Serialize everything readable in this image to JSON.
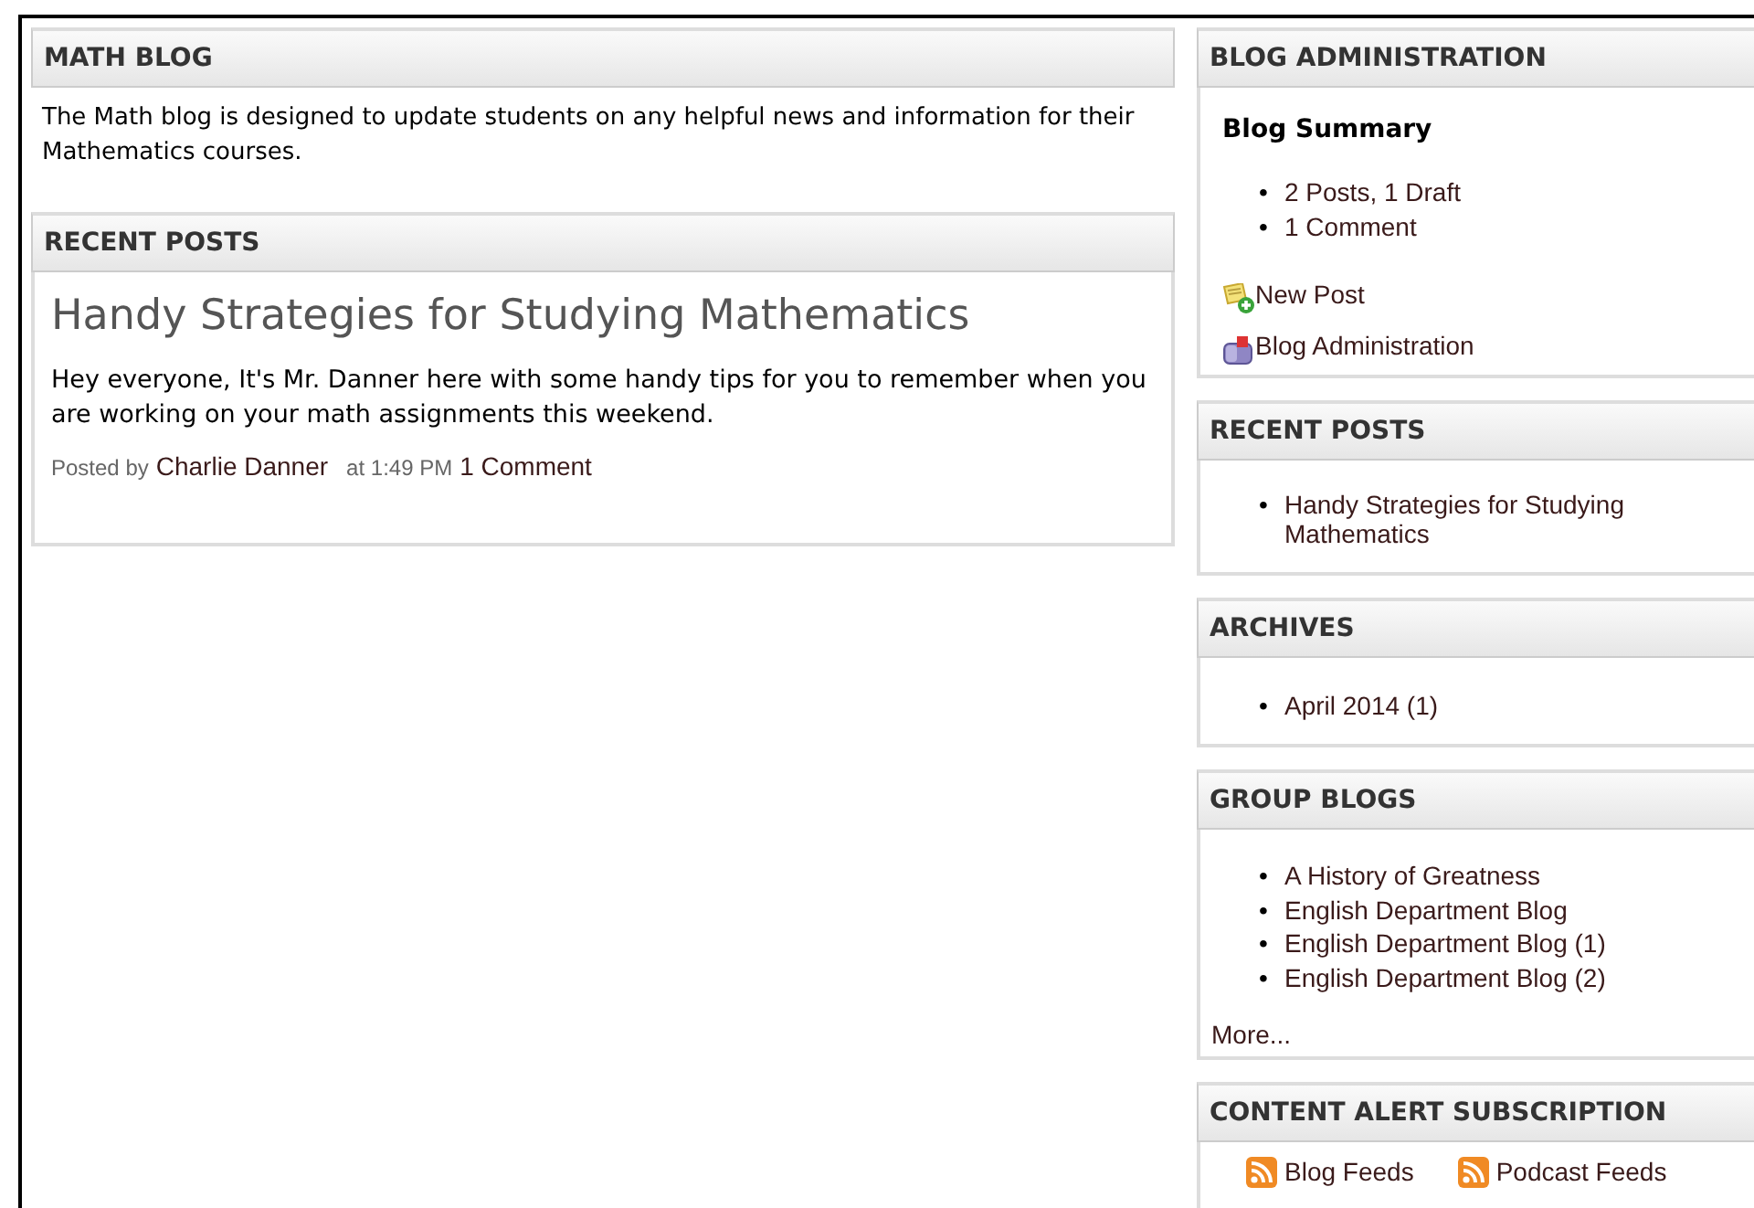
{
  "main": {
    "intro": {
      "title": "MATH BLOG",
      "text": "The Math blog is designed to update students on any helpful news and information for their Mathematics courses."
    },
    "recent_posts": {
      "title": "RECENT POSTS",
      "posts": [
        {
          "title": "Handy Strategies for Studying Mathematics",
          "excerpt": "Hey everyone, It's Mr. Danner here with some handy tips for you to remember when you are working on your math assignments this weekend.",
          "posted_by": "Posted by",
          "author": "Charlie Danner",
          "time": "at 1:49 PM",
          "comments": "1 Comment"
        }
      ]
    }
  },
  "sidebar": {
    "admin": {
      "title": "BLOG ADMINISTRATION",
      "summary_heading": "Blog Summary",
      "summary_items": [
        {
          "bullet": "•",
          "text": "2 Posts, 1 Draft"
        },
        {
          "bullet": "•",
          "text": "1 Comment"
        }
      ],
      "actions": [
        {
          "kind": "new-post",
          "label": "New Post"
        },
        {
          "kind": "admin",
          "label": "Blog Administration"
        }
      ]
    },
    "recent_posts": {
      "title": "RECENT POSTS",
      "items": [
        {
          "bullet": "•",
          "text": "Handy Strategies for Studying Mathematics"
        }
      ]
    },
    "archives": {
      "title": "ARCHIVES",
      "items": [
        {
          "bullet": "•",
          "text": "April 2014 (1)"
        }
      ]
    },
    "group_blogs": {
      "title": "GROUP BLOGS",
      "items": [
        {
          "bullet": "•",
          "text": "A History of Greatness"
        },
        {
          "bullet": "•",
          "text": "English Department Blog"
        },
        {
          "bullet": "•",
          "text": "English Department Blog (1)"
        },
        {
          "bullet": "•",
          "text": "English Department Blog (2)"
        }
      ],
      "more": "More..."
    },
    "subscription": {
      "title": "CONTENT ALERT SUBSCRIPTION",
      "feeds": [
        "Blog Feeds",
        "Podcast Feeds"
      ]
    }
  }
}
